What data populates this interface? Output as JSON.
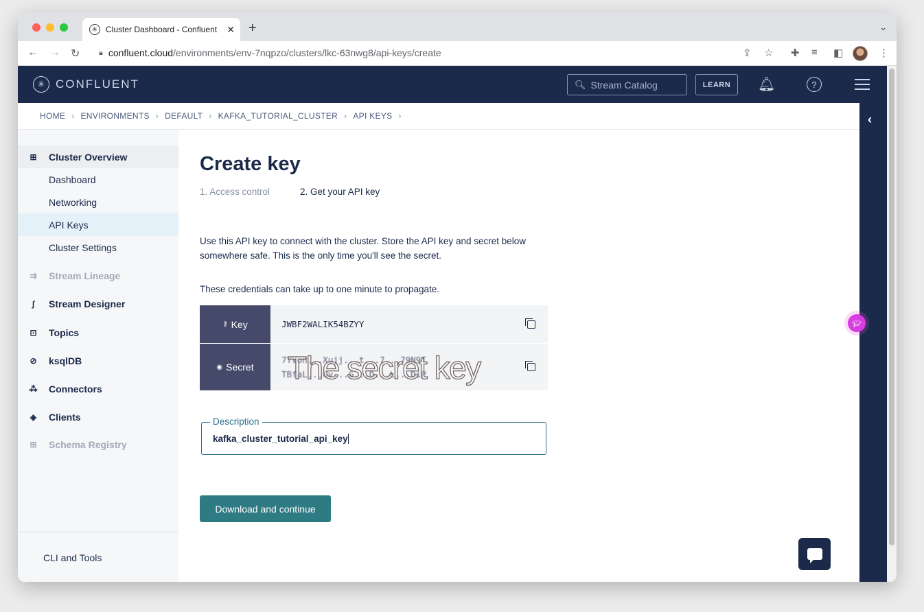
{
  "browser": {
    "tab_title": "Cluster Dashboard - Confluent",
    "url_host": "confluent.cloud",
    "url_path": "/environments/env-7nqpzo/clusters/lkc-63nwg8/api-keys/create"
  },
  "header": {
    "logo_text": "CONFLUENT",
    "search_placeholder": "Stream Catalog",
    "learn_label": "LEARN"
  },
  "breadcrumb": [
    "HOME",
    "ENVIRONMENTS",
    "DEFAULT",
    "KAFKA_TUTORIAL_CLUSTER",
    "API KEYS"
  ],
  "sidebar": {
    "overview": "Cluster Overview",
    "sub_items": [
      "Dashboard",
      "Networking",
      "API Keys",
      "Cluster Settings"
    ],
    "sections": [
      "Stream Lineage",
      "Stream Designer",
      "Topics",
      "ksqlDB",
      "Connectors",
      "Clients",
      "Schema Registry"
    ],
    "cli": "CLI and Tools"
  },
  "main": {
    "title": "Create key",
    "step1": "1. Access control",
    "step2": "2. Get your API key",
    "info": "Use this API key to connect with the cluster. Store the API key and secret below somewhere safe. This is the only time you'll see the secret.",
    "propagate": "These credentials can take up to one minute to propagate.",
    "key_label": "Key",
    "key_value": "JWBF2WALIK54BZYY",
    "secret_label": "Secret",
    "secret_line1": "7YVon...Xujj...t...7...79N9T",
    "secret_line2": "TBfaL...Gv...G...D...L...DiP",
    "overlay_text": "The secret key",
    "description_label": "Description",
    "description_value": "kafka_cluster_tutorial_api_key",
    "download_button": "Download and continue"
  }
}
